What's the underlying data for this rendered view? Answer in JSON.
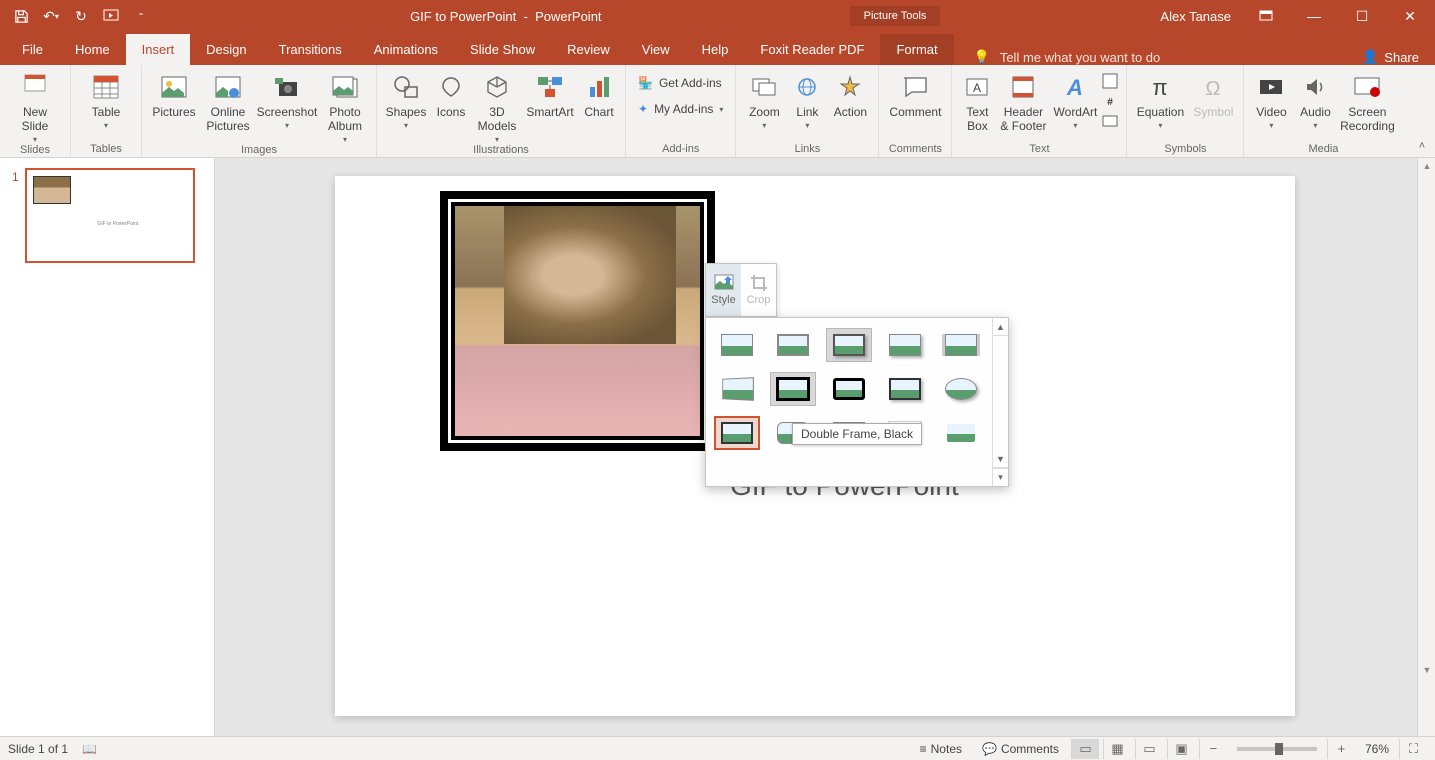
{
  "title": {
    "doc": "GIF to PowerPoint",
    "app": "PowerPoint"
  },
  "user": "Alex Tanase",
  "context_tab": "Picture Tools",
  "tabs": {
    "file": "File",
    "home": "Home",
    "insert": "Insert",
    "design": "Design",
    "transitions": "Transitions",
    "animations": "Animations",
    "slideshow": "Slide Show",
    "review": "Review",
    "view": "View",
    "help": "Help",
    "foxit": "Foxit Reader PDF",
    "format": "Format"
  },
  "tell_me": "Tell me what you want to do",
  "share": "Share",
  "ribbon": {
    "slides": {
      "new_slide": "New\nSlide",
      "group": "Slides"
    },
    "tables": {
      "table": "Table",
      "group": "Tables"
    },
    "images": {
      "pictures": "Pictures",
      "online": "Online\nPictures",
      "screenshot": "Screenshot",
      "album": "Photo\nAlbum",
      "group": "Images"
    },
    "illus": {
      "shapes": "Shapes",
      "icons": "Icons",
      "models": "3D\nModels",
      "smartart": "SmartArt",
      "chart": "Chart",
      "group": "Illustrations"
    },
    "addins": {
      "get": "Get Add-ins",
      "my": "My Add-ins",
      "group": "Add-ins"
    },
    "links": {
      "zoom": "Zoom",
      "link": "Link",
      "action": "Action",
      "group": "Links"
    },
    "comments": {
      "comment": "Comment",
      "group": "Comments"
    },
    "text": {
      "textbox": "Text\nBox",
      "header": "Header\n& Footer",
      "wordart": "WordArt",
      "group": "Text"
    },
    "symbols": {
      "equation": "Equation",
      "symbol": "Symbol",
      "group": "Symbols"
    },
    "media": {
      "video": "Video",
      "audio": "Audio",
      "screen": "Screen\nRecording",
      "group": "Media"
    }
  },
  "mini": {
    "style": "Style",
    "crop": "Crop"
  },
  "tooltip": "Double Frame, Black",
  "slide": {
    "title": "GIF to PowerPoint",
    "num": "1"
  },
  "status": {
    "slide": "Slide 1 of 1",
    "notes": "Notes",
    "comments": "Comments",
    "zoom": "76%"
  }
}
